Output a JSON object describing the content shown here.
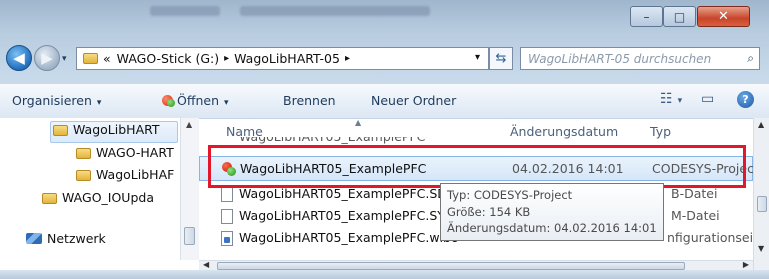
{
  "window_buttons": {
    "minimize": "–",
    "maximize": "□",
    "close": "✕"
  },
  "nav": {
    "crumbs": [
      "«",
      "WAGO-Stick (G:)",
      "WagoLibHART-05"
    ],
    "separator": "▸",
    "dropdown": "▾",
    "refresh_icon": "⇆",
    "search_placeholder": "WagoLibHART-05 durchsuchen",
    "search_icon": "⌕"
  },
  "toolbar": {
    "organize": "Organisieren",
    "open": "Öffnen",
    "burn": "Brennen",
    "new_folder": "Neuer Ordner",
    "caret": "▾",
    "view_icon": "☷",
    "preview_icon": "▭",
    "help_icon": "?"
  },
  "tree": [
    {
      "label": "WagoLibHART",
      "selected": true
    },
    {
      "label": "WAGO-HART"
    },
    {
      "label": "WagoLibHAF"
    },
    {
      "label": "WAGO_IOUpda"
    },
    {
      "label": "Netzwerk"
    }
  ],
  "columns": {
    "name": "Name",
    "date": "Änderungsdatum",
    "type": "Typ"
  },
  "files": [
    {
      "name": "WagoLibHART05_ExamplePFC",
      "date": "04.02.2016 14:01",
      "type": "CODESYS-Project",
      "icon": "codesys-icon",
      "selected": true
    },
    {
      "name": "WagoLibHART05_ExamplePFC.SDB",
      "date": "",
      "type": "B-Datei",
      "icon": "file-icon"
    },
    {
      "name": "WagoLibHART05_ExamplePFC.SYM",
      "date": "",
      "type": "M-Datei",
      "icon": "file-icon"
    },
    {
      "name": "WagoLibHART05_ExamplePFC.wibo",
      "date": "",
      "type": "nfigurationsein",
      "icon": "config-file-icon"
    }
  ],
  "tooltip": {
    "type_line": "Typ: CODESYS-Project",
    "size_line": "Größe: 154 KB",
    "date_line": "Änderungsdatum: 04.02.2016 14:01"
  },
  "colors": {
    "highlight_border": "#e2172b",
    "selection": "#d5e6f8"
  }
}
